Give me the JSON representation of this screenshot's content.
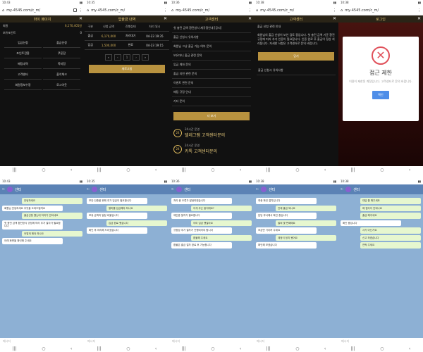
{
  "browser": {
    "url": "my-4545.com/c_m/",
    "times": [
      "10:43",
      "10:35",
      "10:36",
      "10:38",
      "10:38"
    ]
  },
  "panel1": {
    "title": "마이 페이지",
    "account_label": "회원",
    "balance": "6,170,405원",
    "point_label": "보유포인트",
    "point_value": "0",
    "menu": [
      "입금신청",
      "출금신청",
      "포인트전환",
      "쿠폰함",
      "배팅내역",
      "쪽지함",
      "고객센터",
      "출석체크",
      "회원정보수정",
      "로그아웃"
    ]
  },
  "panel2": {
    "title": "입출금 내역",
    "headers": [
      "구분",
      "신청 금액",
      "진행상태",
      "처리 일시"
    ],
    "rows": [
      {
        "type": "출금",
        "amount": "6,170,000",
        "status": "처리대기",
        "date": "04-23 19:35"
      },
      {
        "type": "입금",
        "amount": "1,500,000",
        "status": "완료",
        "date": "04-23 19:15"
      }
    ],
    "pages": [
      "«",
      "‹",
      "1",
      "›",
      "»"
    ],
    "button": "새로고침"
  },
  "panel3": {
    "title": "고객센터",
    "items": [
      "첫 충전 금액 환전방식 재규정안내 [공지]",
      "출금 신청시 유의사항",
      "회원님 그냥 출금 가능 여부 문의",
      "보유머니 출금 관련 문의",
      "입금 계좌 문의",
      "출금 지연 관련 문의",
      "이벤트 관련 문의",
      "배팅 규정 안내",
      "기타 문의"
    ],
    "more": "더 보기",
    "cs1_label": "24시간 운영",
    "cs1_title": "텔레그램 고객센터문의",
    "cs2_label": "24시간 운영",
    "cs2_title": "카톡 고객센터문의"
  },
  "panel4": {
    "title": "고객센터",
    "subject": "출금 신청 관련 안내",
    "body": "회원님의 출금 신청이 보안 검토 중입니다. 첫 충전 금액 기준 환전 규정에 따라 추가 인증이 필요합니다. 인증 완료 후 출금이 정상 처리됩니다. 자세한 사항은 고객센터로 문의 바랍니다.",
    "button": "닫기",
    "bottom_item": "출금 신청시 유의사항"
  },
  "panel5": {
    "title": "로그인",
    "modal_title": "접근 제한",
    "modal_text": "이용이 제한된 계정입니다. 고객센터로 문의 바랍니다.",
    "modal_button": "확인"
  },
  "chat": {
    "name": "센터",
    "input_placeholder": "메시지",
    "c1": [
      {
        "side": "out",
        "text": "안녕하세요"
      },
      {
        "side": "in",
        "text": "회원님 안녕하세요 무엇을 도와드릴까요"
      },
      {
        "side": "out",
        "text": "출금신청 했는데 처리가 안되네요"
      },
      {
        "side": "in",
        "text": "첫 충전 금액 환전방식 규정에 따라 추가 절차가 필요합니다"
      },
      {
        "side": "out",
        "text": "어떻게 해야 하나요"
      },
      {
        "side": "in",
        "text": "아래 화면을 확인해 주세요"
      }
    ],
    "c2": [
      {
        "side": "in",
        "text": "보안 인증을 위해 추가 입금이 필요합니다"
      },
      {
        "side": "out",
        "text": "얼마를 입금해야 하나요"
      },
      {
        "side": "in",
        "text": "보유 금액의 일정 비율입니다"
      },
      {
        "side": "out",
        "text": "입금 완료 했습니다"
      },
      {
        "side": "in",
        "text": "확인 후 처리해 드리겠습니다"
      }
    ],
    "c3": [
      {
        "side": "in",
        "text": "처리 중 오류가 발생하였습니다"
      },
      {
        "side": "out",
        "text": "이게 무슨 말이에요?"
      },
      {
        "side": "in",
        "text": "재인증 절차가 필요합니다"
      },
      {
        "side": "out",
        "text": "이미 입금 했잖아요"
      },
      {
        "side": "in",
        "text": "규정상 추가 절차가 진행되어야 합니다"
      },
      {
        "side": "out",
        "text": "환불해 주세요"
      },
      {
        "side": "in",
        "text": "환불은 출금 절차 완료 후 가능합니다"
      }
    ],
    "c4": [
      {
        "side": "in",
        "text": "최종 확인 절차입니다"
      },
      {
        "side": "out",
        "text": "언제 출금 되나요"
      },
      {
        "side": "in",
        "text": "담당 부서에서 확인 중입니다"
      },
      {
        "side": "out",
        "text": "벌써 몇 번째에요"
      },
      {
        "side": "in",
        "text": "조금만 기다려 주세요"
      },
      {
        "side": "out",
        "text": "계정이 정지 됐어요"
      },
      {
        "side": "in",
        "text": "확인해 보겠습니다"
      }
    ],
    "c5": [
      {
        "side": "out",
        "text": "대답 좀 해주세요"
      },
      {
        "side": "out",
        "text": "왜 접속이 안되나요"
      },
      {
        "side": "out",
        "text": "출금 해주세요"
      },
      {
        "side": "in",
        "text": "확인 중입니다"
      },
      {
        "side": "out",
        "text": "사기 아닌가요"
      },
      {
        "side": "out",
        "text": "신고 하겠습니다"
      },
      {
        "side": "out",
        "text": "연락 주세요"
      }
    ]
  }
}
